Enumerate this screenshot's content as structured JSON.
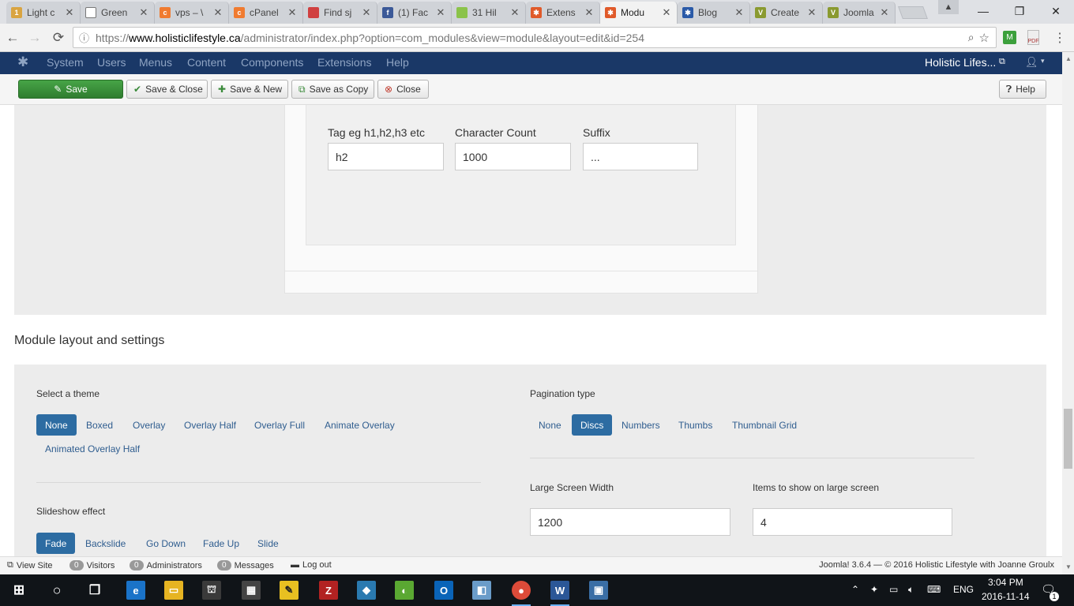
{
  "browser": {
    "tabs": [
      {
        "title": "Light c",
        "color": "#d9a441"
      },
      {
        "title": "Green",
        "color": "#777777"
      },
      {
        "title": "vps – \\",
        "color": "#f07b30"
      },
      {
        "title": "cPanel",
        "color": "#f07b30"
      },
      {
        "title": "Find sj",
        "color": "#d04040"
      },
      {
        "title": "(1) Fac",
        "color": "#3b5998"
      },
      {
        "title": "31 Hil",
        "color": "#8bc34a"
      },
      {
        "title": "Extens",
        "color": "#e05a2a"
      },
      {
        "title": "Modu",
        "color": "#e05a2a"
      },
      {
        "title": "Blog",
        "color": "#2a5aa8"
      },
      {
        "title": "Create",
        "color": "#8a9a30"
      },
      {
        "title": "Joomla",
        "color": "#8a9a30"
      }
    ],
    "active_tab": 8,
    "url_prefix": "https://",
    "url_domain": "www.holisticlifestyle.ca",
    "url_path": "/administrator/index.php?option=com_modules&view=module&layout=edit&id=254"
  },
  "joomla_nav": {
    "logo": "joomla-icon",
    "items": [
      "System",
      "Users",
      "Menus",
      "Content",
      "Components",
      "Extensions",
      "Help"
    ],
    "site_name": "Holistic Lifes...",
    "user_icon": "user-icon"
  },
  "toolbar": {
    "save": "Save",
    "save_close": "Save & Close",
    "save_new": "Save & New",
    "save_copy": "Save as Copy",
    "close": "Close",
    "help": "Help"
  },
  "title_settings": {
    "tag_label": "Tag eg h1,h2,h3 etc",
    "tag_value": "h2",
    "count_label": "Character Count",
    "count_value": "1000",
    "suffix_label": "Suffix",
    "suffix_value": "..."
  },
  "module_layout": {
    "heading": "Module layout and settings",
    "theme_label": "Select a theme",
    "themes": [
      "None",
      "Boxed",
      "Overlay",
      "Overlay Half",
      "Overlay Full",
      "Animate Overlay",
      "Animated Overlay Half"
    ],
    "theme_selected": "None",
    "effect_label": "Slideshow effect",
    "effects": [
      "Fade",
      "Backslide",
      "Go Down",
      "Fade Up",
      "Slide"
    ],
    "effect_selected": "Fade",
    "pagination_label": "Pagination type",
    "paginations": [
      "None",
      "Discs",
      "Numbers",
      "Thumbs",
      "Thumbnail Grid"
    ],
    "pagination_selected": "Discs",
    "large_width_label": "Large Screen Width",
    "large_width_value": "1200",
    "items_large_label": "Items to show on large screen",
    "items_large_value": "4"
  },
  "statusbar": {
    "view_site": "View Site",
    "visitors_count": "0",
    "visitors": "Visitors",
    "admins_count": "0",
    "admins": "Administrators",
    "messages_count": "0",
    "messages": "Messages",
    "logout": "Log out",
    "footer": "Joomla! 3.6.4 — © 2016 Holistic Lifestyle with Joanne Groulx"
  },
  "taskbar": {
    "lang": "ENG",
    "time": "3:04 PM",
    "date": "2016-11-14",
    "notifications": "1"
  }
}
